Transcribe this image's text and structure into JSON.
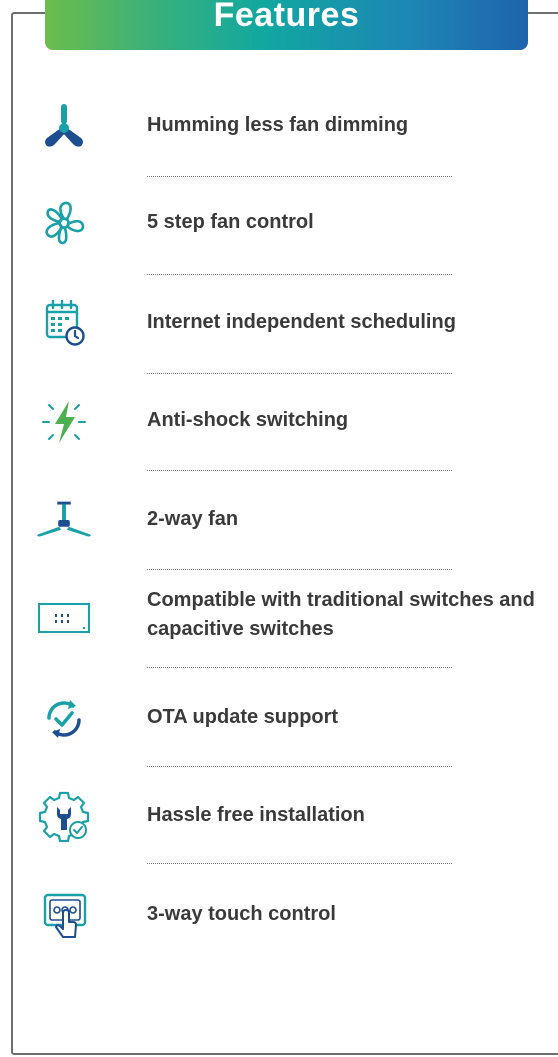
{
  "header": {
    "title": "Features"
  },
  "features": [
    {
      "label": "Humming less fan dimming",
      "icon": "fan-blades-icon"
    },
    {
      "label": "5 step fan  control",
      "icon": "propeller-icon"
    },
    {
      "label": "Internet independent scheduling",
      "icon": "calendar-clock-icon"
    },
    {
      "label": "Anti-shock switching",
      "icon": "lightning-icon"
    },
    {
      "label": "2-way fan",
      "icon": "ceiling-fan-icon"
    },
    {
      "label": "Compatible with traditional switches and capacitive switches",
      "icon": "switch-panel-icon"
    },
    {
      "label": "OTA update support",
      "icon": "sync-check-icon"
    },
    {
      "label": "Hassle free installation",
      "icon": "gear-wrench-icon"
    },
    {
      "label": "3-way touch control",
      "icon": "touch-panel-icon"
    }
  ],
  "colors": {
    "teal": "#1aa0a8",
    "navy": "#1d4e8f",
    "green": "#4caf50",
    "text": "#3a3a3a",
    "gradient_start": "#6cbd4b",
    "gradient_end": "#1e63ad"
  }
}
